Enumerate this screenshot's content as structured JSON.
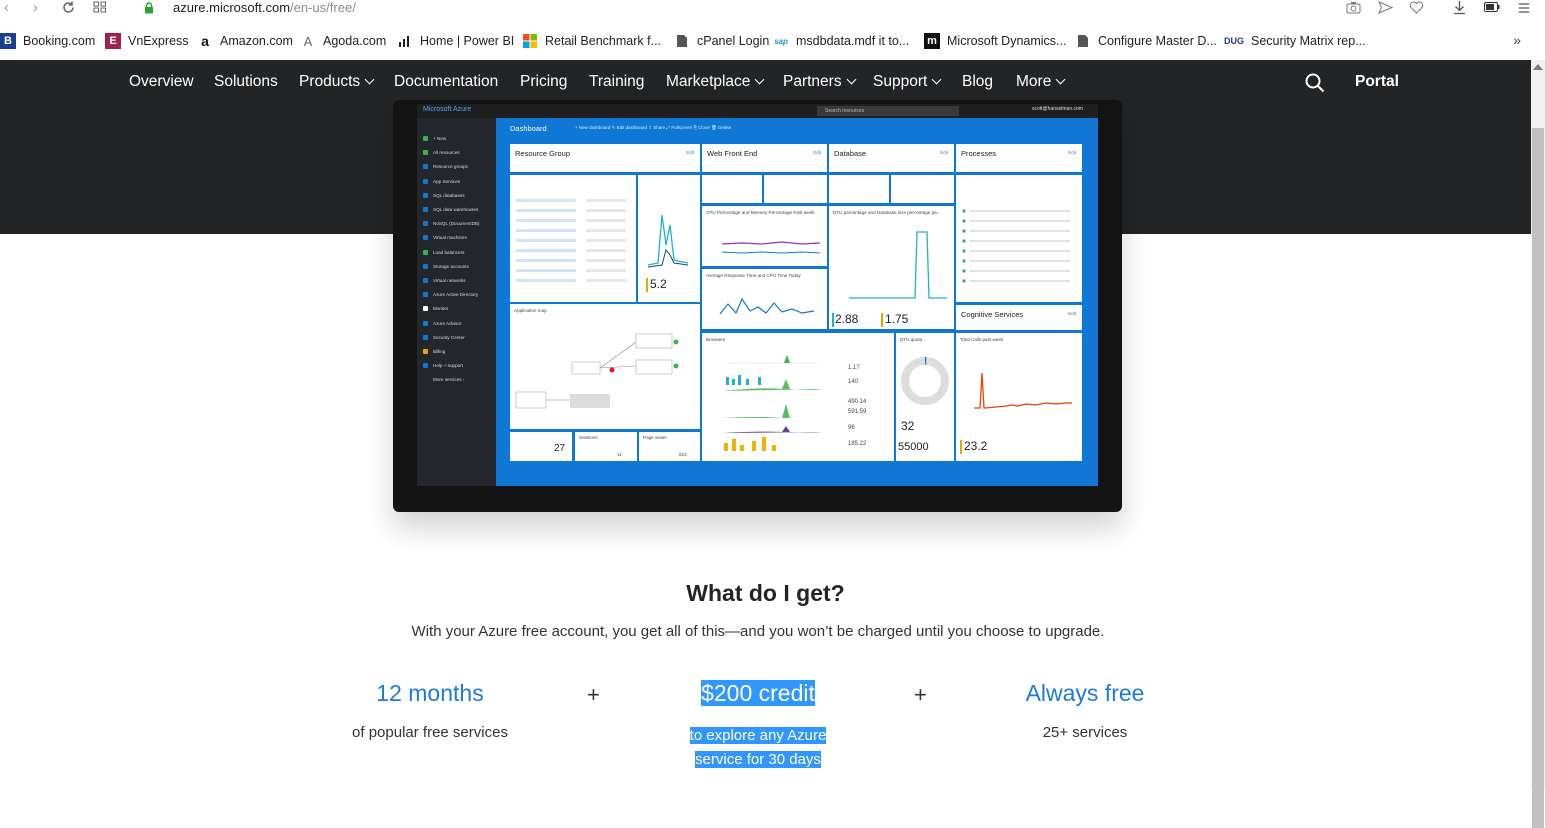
{
  "browser": {
    "url_host": "azure.microsoft.com",
    "url_path": "/en-us/free/",
    "bookmarks": [
      {
        "label": "Booking.com",
        "icon": "booking-icon",
        "color": "#1a3f8c",
        "glyph": "B"
      },
      {
        "label": "VnExpress",
        "icon": "vnexpress-icon",
        "color": "#9f224e",
        "glyph": "E"
      },
      {
        "label": "Amazon.com",
        "icon": "amazon-icon",
        "color": "#111111",
        "glyph": "a"
      },
      {
        "label": "Agoda.com",
        "icon": "agoda-icon",
        "color": "#5a5a5a",
        "glyph": "A"
      },
      {
        "label": "Home | Power BI",
        "icon": "powerbi-icon",
        "color": "#222222",
        "glyph": ""
      },
      {
        "label": "Retail Benchmark f...",
        "icon": "microsoft-icon",
        "color": "#f25022",
        "glyph": ""
      },
      {
        "label": "cPanel Login",
        "icon": "page-icon",
        "color": "#555555",
        "glyph": ""
      },
      {
        "label": "msdbdata.mdf it to...",
        "icon": "sap-icon",
        "color": "#1a8fd6",
        "glyph": "sap"
      },
      {
        "label": "Microsoft Dynamics...",
        "icon": "dynamics-icon",
        "color": "#111111",
        "glyph": "m"
      },
      {
        "label": "Configure Master D...",
        "icon": "page-icon",
        "color": "#555555",
        "glyph": ""
      },
      {
        "label": "Security Matrix rep...",
        "icon": "dug-icon",
        "color": "#1f3a8a",
        "glyph": "DUG"
      }
    ],
    "bookmarks_more": "»"
  },
  "site_nav": {
    "items": [
      {
        "label": "Overview",
        "dropdown": false
      },
      {
        "label": "Solutions",
        "dropdown": false
      },
      {
        "label": "Products",
        "dropdown": true
      },
      {
        "label": "Documentation",
        "dropdown": false
      },
      {
        "label": "Pricing",
        "dropdown": false
      },
      {
        "label": "Training",
        "dropdown": false
      },
      {
        "label": "Marketplace",
        "dropdown": true
      },
      {
        "label": "Partners",
        "dropdown": true
      },
      {
        "label": "Support",
        "dropdown": true
      },
      {
        "label": "Blog",
        "dropdown": false
      },
      {
        "label": "More",
        "dropdown": true
      }
    ],
    "portal_label": "Portal"
  },
  "dashboard_image": {
    "brand": "Microsoft Azure",
    "search_placeholder": "Search resources",
    "user": "scott@hanselman.com",
    "title": "Dashboard",
    "actions": "+ New dashboard   ✎ Edit dashboard   ⇪ Share   ⤢ Fullscreen   ⎘ Clone   🗑 Delete",
    "sidebar": [
      "+ New",
      "All resources",
      "Resource groups",
      "App Services",
      "SQL databases",
      "SQL data warehouses",
      "NoSQL (DocumentDB)",
      "Virtual machines",
      "Load balancers",
      "Storage accounts",
      "Virtual networks",
      "Azure Active Directory",
      "Monitor",
      "Azure Advisor",
      "Security Center",
      "Billing",
      "Help + support",
      "More services ›"
    ],
    "tiles": {
      "resource_group": "Resource Group",
      "web_front_end": "Web Front End",
      "database": "Database",
      "processes": "Processes",
      "cognitive_services": "Cognitive Services",
      "edit": "Edit",
      "http_value": "5.2",
      "cpu_label": "CPU Percentage and Memory Percentage Past week",
      "response_label": "Average Response Time and CPU Time Today",
      "dtu_label": "DTU percentage and Database size percentage pa...",
      "dtu_pct": "2.88",
      "db_size_pct": "1.75",
      "app_map": "Application map",
      "browsers": "Browsers",
      "dtu_quota": "DTU quota",
      "current_dtu": "32",
      "quota_dtu": "55000",
      "total_calls_label": "Total Calls past week",
      "total_calls": "23.2",
      "activity_count": "27",
      "sessions_label": "Sessions",
      "sessions": "11",
      "page_views_label": "Page views",
      "page_views": "623",
      "page_load": "1.17",
      "page_view_count": "140",
      "client_processing": "490.14",
      "send_request": "591.59",
      "browser_exceptions": "96",
      "dependency": "185.22"
    }
  },
  "offer": {
    "title": "What do I get?",
    "subtitle": "With your Azure free account, you get all of this—and you won’t be charged until you choose to upgrade.",
    "items": [
      {
        "headline": "12 months",
        "description": "of popular free services"
      },
      {
        "headline": "$200 credit",
        "description": "to explore any Azure service for 30 days"
      },
      {
        "headline": "Always free",
        "description": "25+ services"
      }
    ],
    "plus": "+"
  },
  "colors": {
    "accent": "#1f7bd6",
    "nav_bg": "#222426",
    "selection": "#3296ff",
    "portal_blue": "#0f78d4"
  }
}
